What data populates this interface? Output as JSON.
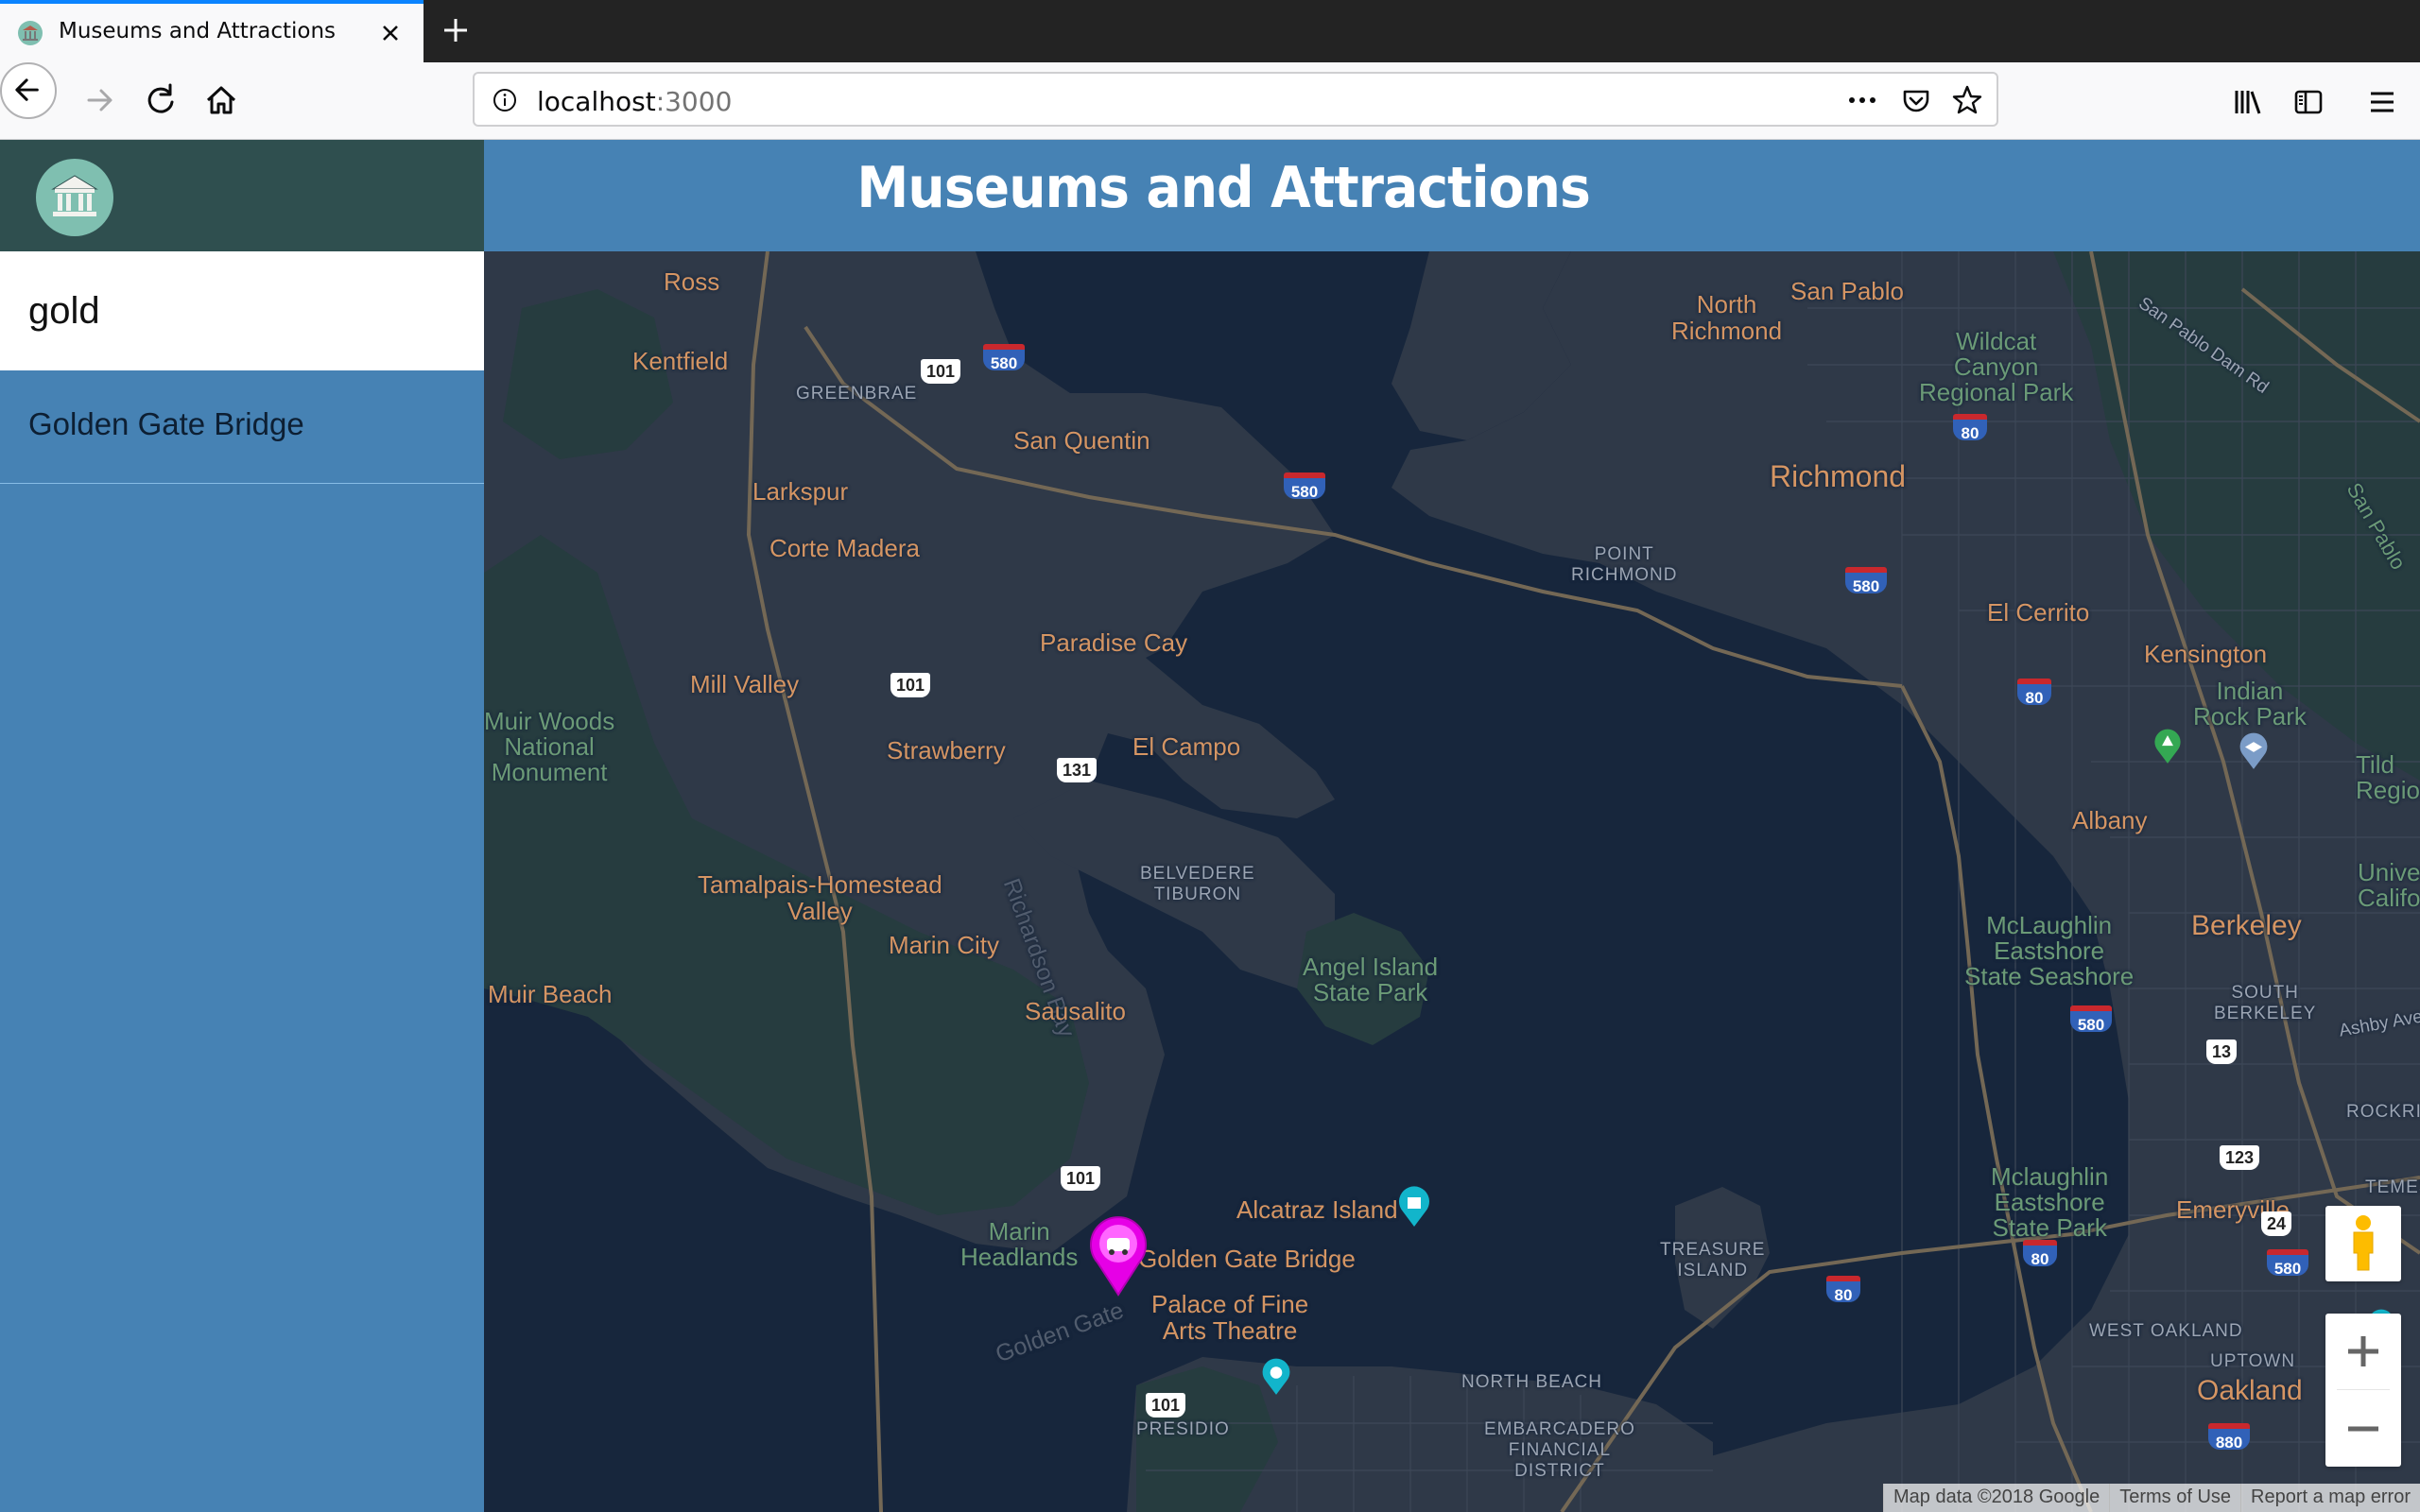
{
  "browser": {
    "tab_title": "Museums and Attractions",
    "url_host": "localhost",
    "url_port": ":3000"
  },
  "app": {
    "title": "Museums and Attractions",
    "search": {
      "value": "gold"
    },
    "results": [
      {
        "label": "Golden Gate Bridge"
      }
    ]
  },
  "map": {
    "places": {
      "ross": "Ross",
      "kentfield": "Kentfield",
      "greenbrae": "GREENBRAE",
      "san_quentin": "San Quentin",
      "larkspur": "Larkspur",
      "corte_madera": "Corte Madera",
      "north_richmond": "North\nRichmond",
      "san_pablo": "San Pablo",
      "wildcat": "Wildcat\nCanyon\nRegional Park",
      "richmond": "Richmond",
      "point_richmond": "POINT\nRICHMOND",
      "el_cerrito": "El Cerrito",
      "kensington": "Kensington",
      "indian_rock": "Indian\nRock Park",
      "paradise_cay": "Paradise Cay",
      "mill_valley": "Mill Valley",
      "muir_woods": "Muir Woods\nNational\nMonument",
      "strawberry": "Strawberry",
      "el_campo": "El Campo",
      "albany": "Albany",
      "tilden": "Tild\nRegiona",
      "richardson_bay": "Richardson Bay",
      "belvedere": "BELVEDERE\nTIBURON",
      "tamalpais": "Tamalpais-Homestead\nValley",
      "marin_city": "Marin City",
      "angel_island": "Angel Island\nState Park",
      "mclaughlin1": "McLaughlin\nEastshore\nState Seashore",
      "berkeley": "Berkeley",
      "university": "Univers\nCalifo",
      "muir_beach": "Muir Beach",
      "sausalito": "Sausalito",
      "south_berkeley": "SOUTH\nBERKELEY",
      "ashby": "Ashby Ave",
      "rockridge": "ROCKRIDGE",
      "alcatraz": "Alcatraz Island",
      "mclaughlin2": "Mclaughlin\nEastshore\nState Park",
      "emeryville": "Emeryville",
      "temescal": "TEMES",
      "marin_headlands": "Marin\nHeadlands",
      "golden_gate_bridge": "Golden Gate Bridge",
      "treasure_island": "TREASURE\nISLAND",
      "golden_gate": "Golden Gate",
      "palace_fine_arts": "Palace of Fine\nArts Theatre",
      "west_oakland": "WEST OAKLAND",
      "uptown": "UPTOWN",
      "oakland": "Oakland",
      "north_beach": "NORTH BEACH",
      "presidio": "PRESIDIO",
      "embarcadero": "EMBARCADERO\nFINANCIAL\nDISTRICT",
      "san_pablo_dam": "San Pablo Dam Rd",
      "san_pablo_ridge": "San Pablo"
    },
    "shields": {
      "us101_a": "101",
      "us101_b": "101",
      "us101_c": "101",
      "us101_d": "101",
      "ca131": "131",
      "ca13": "13",
      "ca123": "123",
      "ca24": "24"
    },
    "interstates": {
      "i580_a": "580",
      "i580_b": "580",
      "i580_c": "580",
      "i580_d": "580",
      "i580_e": "580",
      "i80_a": "80",
      "i80_b": "80",
      "i80_c": "80",
      "i80_d": "80",
      "i880": "880"
    },
    "footer": {
      "data": "Map data ©2018 Google",
      "terms": "Terms of Use",
      "report": "Report a map error"
    },
    "colors": {
      "water": "#17263c",
      "land": "#2f3948",
      "park": "#263c3f",
      "road": "#746855",
      "marker": "#e600e6"
    }
  }
}
